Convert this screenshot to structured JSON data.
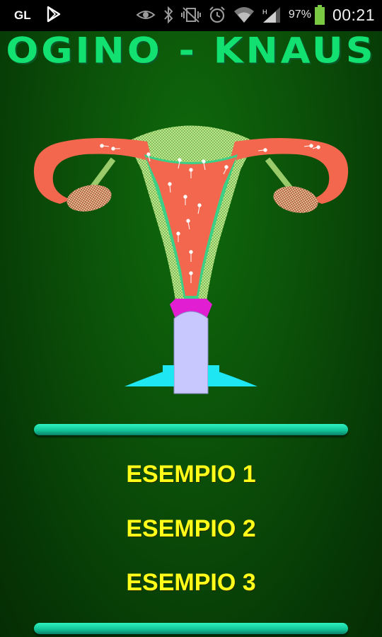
{
  "status_bar": {
    "left_icons": [
      "gl-icon",
      "play-store-icon"
    ],
    "right_icons": [
      "eye-icon",
      "bluetooth-icon",
      "vibrate-icon",
      "alarm-icon",
      "wifi-icon",
      "signal-icon",
      "battery-icon"
    ],
    "battery_percent": "97%",
    "time": "00:21",
    "colors": {
      "background": "#000000",
      "battery": "#7ac943"
    }
  },
  "app": {
    "title": "OGINO - KNAUS",
    "title_color": "#12e070",
    "illustration_icon": "uterus-illustration-icon"
  },
  "menu": {
    "items": [
      {
        "label": "ESEMPIO 1"
      },
      {
        "label": "ESEMPIO 2"
      },
      {
        "label": "ESEMPIO 3"
      }
    ],
    "label_color": "#ffff19",
    "divider_color": "#1fd9a8"
  }
}
